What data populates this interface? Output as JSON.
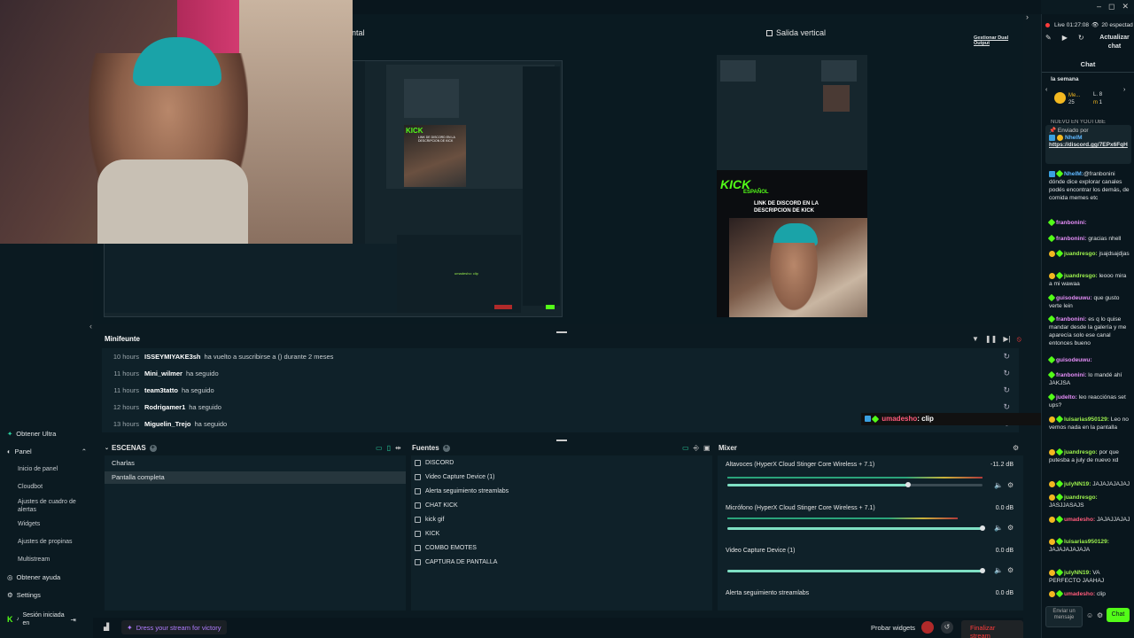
{
  "window": {
    "minimize": "–",
    "maximize": "◻",
    "close": "✕"
  },
  "preview": {
    "horizontal_label": "ntal",
    "vertical_label": "Salida vertical",
    "dual_output_link": "Gestionar Dual Output",
    "overlay_line1": "LINK DE DISCORD EN LA",
    "overlay_line2": "DESCRIPCION DE KICK",
    "kick_logo": "KICK",
    "kick_sub": "ESPAÑOL",
    "small_kick": "KICK",
    "small_overlay": "LINK DE DISCORD EN LA DESCRIPCION DE KICK",
    "small_chat": "umadesho: clip"
  },
  "sidebar": {
    "top_items": [
      {
        "label": "Obtener Ultra"
      },
      {
        "label": "Panel"
      }
    ],
    "sub_items": [
      {
        "label": "Inicio de panel"
      },
      {
        "label": "Cloudbot"
      },
      {
        "label": "Ajustes de cuadro de alertas"
      },
      {
        "label": "Widgets"
      },
      {
        "label": "Ajustes de propinas"
      },
      {
        "label": "Multistream"
      }
    ],
    "bottom_items": [
      {
        "label": "Obtener ayuda"
      },
      {
        "label": "Settings"
      }
    ],
    "session_label": "Sesión iniciada en"
  },
  "minifeed": {
    "title": "Minifeunte",
    "rows": [
      {
        "time": "10 hours",
        "user": "ISSEYMIYAKE3sh",
        "action": "ha vuelto a suscribirse a () durante 2 meses"
      },
      {
        "time": "11 hours",
        "user": "Mini_wilmer",
        "action": "ha seguido"
      },
      {
        "time": "11 hours",
        "user": "team3tatto",
        "action": "ha seguido"
      },
      {
        "time": "12 hours",
        "user": "Rodrigamer1",
        "action": "ha seguido"
      },
      {
        "time": "13 hours",
        "user": "Miguelin_Trejo",
        "action": "ha seguido"
      }
    ],
    "overlay_chat_user": "umadesho",
    "overlay_chat_msg": ": clip"
  },
  "scenes": {
    "title": "ESCENAS",
    "items": [
      {
        "label": "Charlas"
      },
      {
        "label": "Pantalla completa"
      }
    ]
  },
  "sources": {
    "title": "Fuentes",
    "items": [
      {
        "label": "DISCORD"
      },
      {
        "label": "Video Capture Device (1)"
      },
      {
        "label": "Alerta seguimiento streamlabs"
      },
      {
        "label": "CHAT KICK"
      },
      {
        "label": "kick gif"
      },
      {
        "label": "KICK"
      },
      {
        "label": "COMBO EMOTES"
      },
      {
        "label": "CAPTURA DE PANTALLA"
      }
    ]
  },
  "mixer": {
    "title": "Mixer",
    "channels": [
      {
        "name": "Altavoces (HyperX Cloud Stinger Core Wireless + 7.1)",
        "db": "-11.2 dB",
        "level": 0.71
      },
      {
        "name": "Micrófono (HyperX Cloud Stinger Core Wireless + 7.1)",
        "db": "0.0 dB",
        "level": 1.0
      },
      {
        "name": "Video Capture Device (1)",
        "db": "0.0 dB",
        "level": 1.0
      },
      {
        "name": "Alerta seguimiento streamlabs",
        "db": "0.0 dB",
        "level": 1.0
      }
    ]
  },
  "bottombar": {
    "promo": "Dress your stream for victory",
    "probar": "Probar widgets",
    "end_stream": "Finalizar stream"
  },
  "chat": {
    "live": "Live 01:27:08",
    "viewers": "20 espectad",
    "refresh": "Actualizar chat",
    "tab": "Chat",
    "week_label": "la semana",
    "lb1_name": "Me...",
    "lb1_val": "25",
    "lb2_name": "L.",
    "lb2_val": "8",
    "lb3_name": "m",
    "lb3_val": "1",
    "ticker": "NUEVO EN YOUTUBE",
    "pinned_by": "Enviado por",
    "pinned_user": "NhelM",
    "pinned_link": "https://discord.gg/7EPx6FqH",
    "messages": [
      {
        "user": "NhelM:",
        "text": "@franbonini dónde dice explorar canales podés encontrar los demás, de comida memes etc",
        "cls": "un-blue"
      },
      {
        "user": "franbonini:",
        "text": "",
        "cls": "un-pink"
      },
      {
        "user": "franbonini:",
        "text": " gracias nhell",
        "cls": "un-pink"
      },
      {
        "user": "juandresgo:",
        "text": " jsajdsajdjas",
        "cls": "un-green"
      },
      {
        "user": "juandresgo:",
        "text": " leooo mira a mi wawaa",
        "cls": "un-green"
      },
      {
        "user": "guisodeuwu:",
        "text": " que gusto verte lein",
        "cls": "un-pink"
      },
      {
        "user": "franbonini:",
        "text": " es q lo quise mandar desde la galería y me aparecía solo ese canal entonces bueno",
        "cls": "un-pink"
      },
      {
        "user": "guisodeuwu:",
        "text": "",
        "cls": "un-pink"
      },
      {
        "user": "franbonini:",
        "text": " lo mandé ahí JAKJSA",
        "cls": "un-pink"
      },
      {
        "user": "judelto:",
        "text": " leo reacciónas set ups?",
        "cls": "un-pink"
      },
      {
        "user": "luisarias950129:",
        "text": " Leo no vemos nada en la pantalla",
        "cls": "un-green"
      },
      {
        "user": "juandresgo:",
        "text": " por que putesba a july de nuevo xd",
        "cls": "un-green"
      },
      {
        "user": "julyNN19:",
        "text": " JAJAJAJAJAJ",
        "cls": "un-green"
      },
      {
        "user": "juandresgo:",
        "text": " JASJJASAJS",
        "cls": "un-green"
      },
      {
        "user": "umadesho:",
        "text": " JAJAJJAJAJ",
        "cls": "un-red"
      },
      {
        "user": "luisarias950129:",
        "text": " JAJAJAJAJAJA",
        "cls": "un-green"
      },
      {
        "user": "julyNN19:",
        "text": " VA PERFECTO JAAHAJ",
        "cls": "un-green"
      },
      {
        "user": "umadesho:",
        "text": " clip",
        "cls": "un-red"
      }
    ],
    "input_placeholder": "Enviar un mensaje",
    "send": "Chat"
  }
}
